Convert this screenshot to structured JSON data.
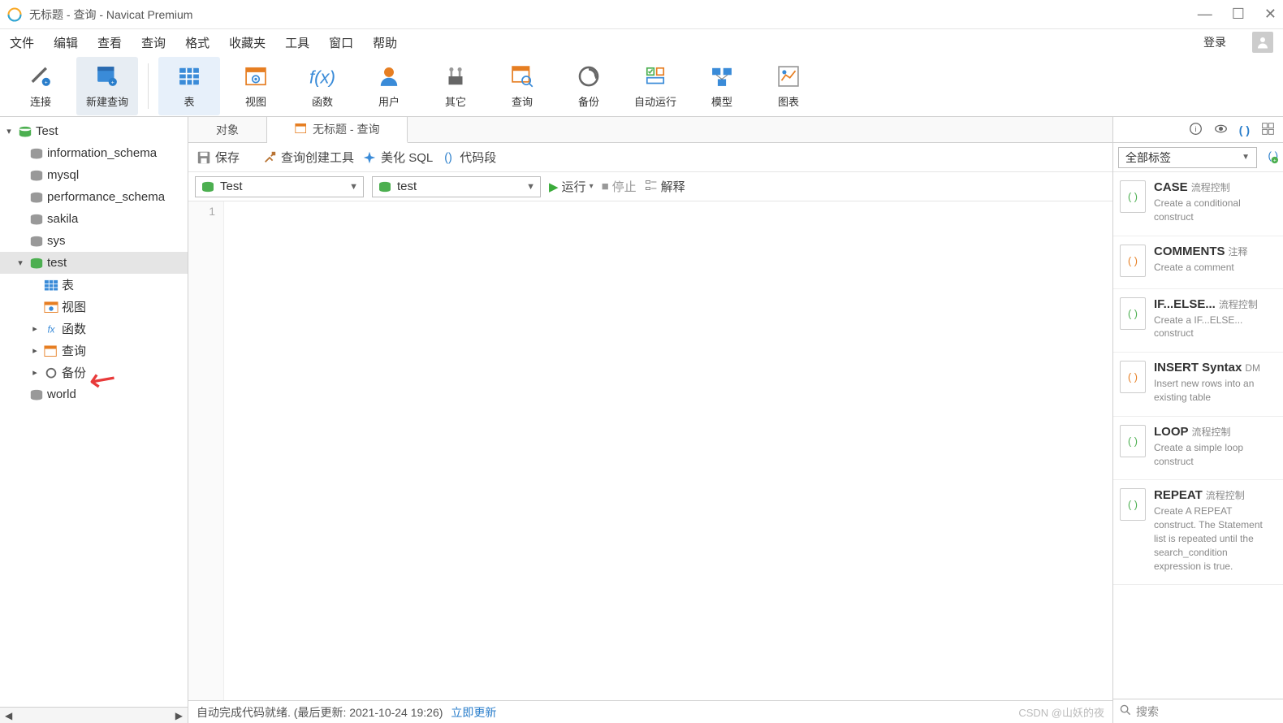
{
  "window": {
    "title": "无标题 - 查询 - Navicat Premium"
  },
  "menubar": {
    "items": [
      "文件",
      "编辑",
      "查看",
      "查询",
      "格式",
      "收藏夹",
      "工具",
      "窗口",
      "帮助"
    ],
    "login": "登录"
  },
  "toolbar": {
    "connect": "连接",
    "new_query": "新建查询",
    "table": "表",
    "view": "视图",
    "function": "函数",
    "user": "用户",
    "other": "其它",
    "query": "查询",
    "backup": "备份",
    "autorun": "自动运行",
    "model": "模型",
    "chart": "图表"
  },
  "tree": {
    "root": "Test",
    "databases": [
      "information_schema",
      "mysql",
      "performance_schema",
      "sakila",
      "sys"
    ],
    "selected_db": "test",
    "children": {
      "tables": "表",
      "views": "视图",
      "functions": "函数",
      "queries": "查询",
      "backups": "备份"
    },
    "last_db": "world"
  },
  "tabs": {
    "objects": "对象",
    "active": "无标题 - 查询"
  },
  "editor_toolbar": {
    "save": "保存",
    "query_builder": "查询创建工具",
    "beautify": "美化 SQL",
    "snippets": "代码段"
  },
  "selectors": {
    "connection": "Test",
    "database": "test",
    "run": "运行",
    "stop": "停止",
    "explain": "解释"
  },
  "editor": {
    "line_number": "1"
  },
  "statusbar": {
    "text": "自动完成代码就绪. (最后更新: 2021-10-24 19:26)",
    "link": "立即更新",
    "watermark": "CSDN @山妖的夜"
  },
  "rightpane": {
    "filter_label": "全部标签",
    "search_placeholder": "搜索",
    "snippets": [
      {
        "title": "CASE",
        "tag": "流程控制",
        "desc": "Create a conditional construct"
      },
      {
        "title": "COMMENTS",
        "tag": "注释",
        "desc": "Create a comment"
      },
      {
        "title": "IF...ELSE...",
        "tag": "流程控制",
        "desc": "Create a IF...ELSE... construct"
      },
      {
        "title": "INSERT Syntax",
        "tag": "DM",
        "desc": "Insert new rows into an existing table"
      },
      {
        "title": "LOOP",
        "tag": "流程控制",
        "desc": "Create a simple loop construct"
      },
      {
        "title": "REPEAT",
        "tag": "流程控制",
        "desc": "Create A REPEAT construct. The Statement list is repeated until the search_condition expression is true."
      }
    ]
  }
}
